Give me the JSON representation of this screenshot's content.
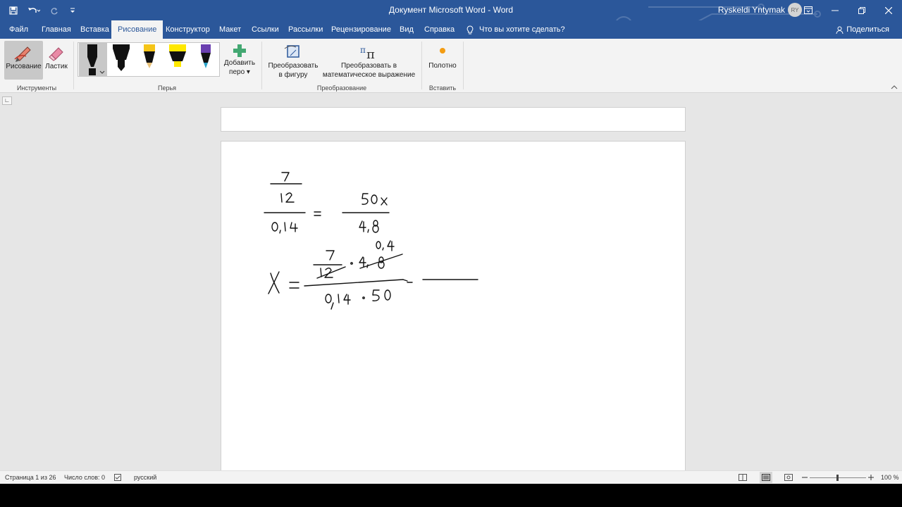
{
  "window": {
    "title": "Документ Microsoft Word  -  Word",
    "user": "Ryskeldi Yntymak",
    "avatar_initials": "RY"
  },
  "tabs": [
    "Файл",
    "Главная",
    "Вставка",
    "Рисование",
    "Конструктор",
    "Макет",
    "Ссылки",
    "Рассылки",
    "Рецензирование",
    "Вид",
    "Справка"
  ],
  "active_tab": "Рисование",
  "tell_me": "Что вы хотите сделать?",
  "share": "Поделиться",
  "ribbon": {
    "tools": {
      "draw": "Рисование",
      "eraser": "Ластик",
      "group": "Инструменты"
    },
    "pens": {
      "group": "Перья",
      "add_line1": "Добавить",
      "add_line2": "перо"
    },
    "convert": {
      "shape_line1": "Преобразовать",
      "shape_line2": "в фигуру",
      "math_line1": "Преобразовать в",
      "math_line2": "математическое выражение",
      "group": "Преобразование"
    },
    "insert": {
      "canvas": "Полотно",
      "group": "Вставить"
    }
  },
  "status": {
    "page": "Страница 1 из 26",
    "words": "Число слов: 0",
    "language": "русский",
    "zoom": "100 %"
  },
  "colors": {
    "accent": "#2b579a",
    "ribbon_bg": "#f3f3f3",
    "doc_bg": "#e6e6e6"
  },
  "icons": [
    "save-icon",
    "undo-icon",
    "redo-icon",
    "customize-icon",
    "ribbon-display-icon",
    "minimize-icon",
    "restore-icon",
    "close-icon",
    "lightbulb-icon",
    "share-person-icon",
    "pencil-icon",
    "eraser-icon",
    "plus-icon",
    "shape-icon",
    "pi-icon",
    "canvas-icon",
    "collapse-ribbon-icon",
    "proofing-icon",
    "read-mode-icon",
    "print-layout-icon",
    "web-layout-icon",
    "zoom-out-icon",
    "zoom-in-icon"
  ]
}
